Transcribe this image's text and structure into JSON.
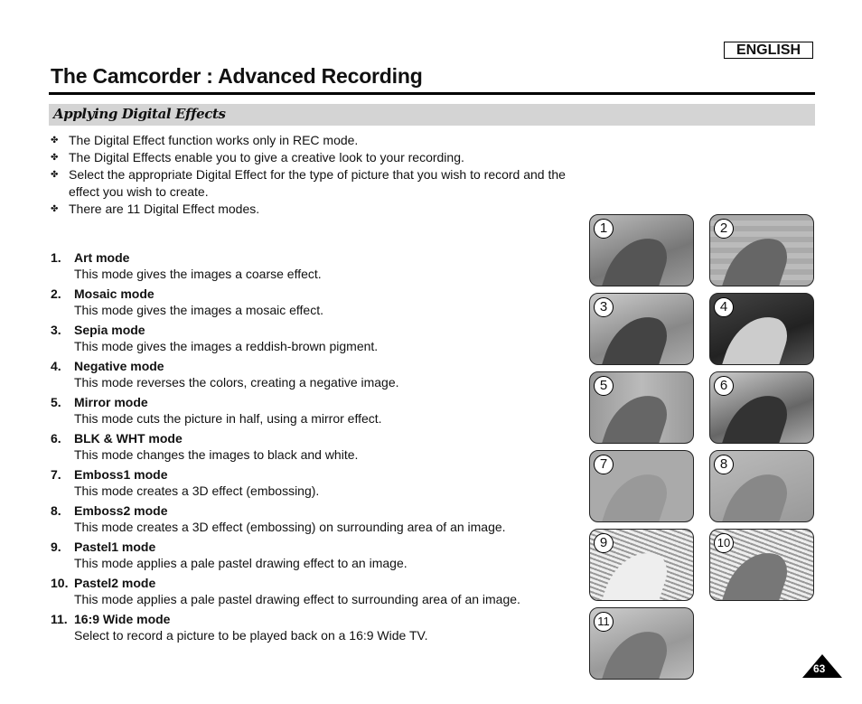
{
  "header": {
    "language": "ENGLISH",
    "title": "The Camcorder : Advanced Recording",
    "section": "Applying Digital Effects"
  },
  "bullets": [
    {
      "icon": "cross-bullet-icon",
      "text": "The Digital Effect function works only in REC mode."
    },
    {
      "icon": "cross-bullet-icon",
      "text": "The Digital Effects enable you to give a creative look to your recording."
    },
    {
      "icon": "cross-bullet-icon",
      "text": "Select the appropriate Digital Effect for the type of picture that you wish to record and the effect you wish to create."
    },
    {
      "icon": "cross-bullet-icon",
      "text": "There are 11 Digital Effect modes."
    }
  ],
  "bullet_marker": "✤",
  "modes": [
    {
      "num": "1.",
      "name": "Art mode",
      "desc": "This mode gives the images a coarse effect."
    },
    {
      "num": "2.",
      "name": "Mosaic mode",
      "desc": "This mode gives the images a mosaic effect."
    },
    {
      "num": "3.",
      "name": "Sepia mode",
      "desc": "This mode gives the images a reddish-brown pigment."
    },
    {
      "num": "4.",
      "name": "Negative mode",
      "desc": "This mode reverses the colors, creating a negative image."
    },
    {
      "num": "5.",
      "name": "Mirror mode",
      "desc": "This mode cuts the picture in half, using a mirror effect."
    },
    {
      "num": "6.",
      "name": "BLK & WHT mode",
      "desc": "This mode changes the images to black and white."
    },
    {
      "num": "7.",
      "name": "Emboss1 mode",
      "desc": "This mode creates a 3D effect (embossing)."
    },
    {
      "num": "8.",
      "name": "Emboss2 mode",
      "desc": "This mode creates a 3D effect (embossing) on surrounding area of an image."
    },
    {
      "num": "9.",
      "name": "Pastel1 mode",
      "desc": "This mode applies a pale pastel drawing effect to an image."
    },
    {
      "num": "10.",
      "name": "Pastel2 mode",
      "desc": "This mode applies a pale pastel drawing effect to surrounding area of an image."
    },
    {
      "num": "11.",
      "name": "16:9 Wide mode",
      "desc": "Select to record a picture to be played back on a 16:9 Wide TV."
    }
  ],
  "thumbnails": [
    {
      "label": "1",
      "effect": "art"
    },
    {
      "label": "2",
      "effect": "mosaic"
    },
    {
      "label": "3",
      "effect": "sepia"
    },
    {
      "label": "4",
      "effect": "negative"
    },
    {
      "label": "5",
      "effect": "mirror"
    },
    {
      "label": "6",
      "effect": "blk-wht"
    },
    {
      "label": "7",
      "effect": "emboss1"
    },
    {
      "label": "8",
      "effect": "emboss2"
    },
    {
      "label": "9",
      "effect": "pastel1"
    },
    {
      "label": "10",
      "effect": "pastel2"
    },
    {
      "label": "11",
      "effect": "wide"
    }
  ],
  "page_number": "63"
}
